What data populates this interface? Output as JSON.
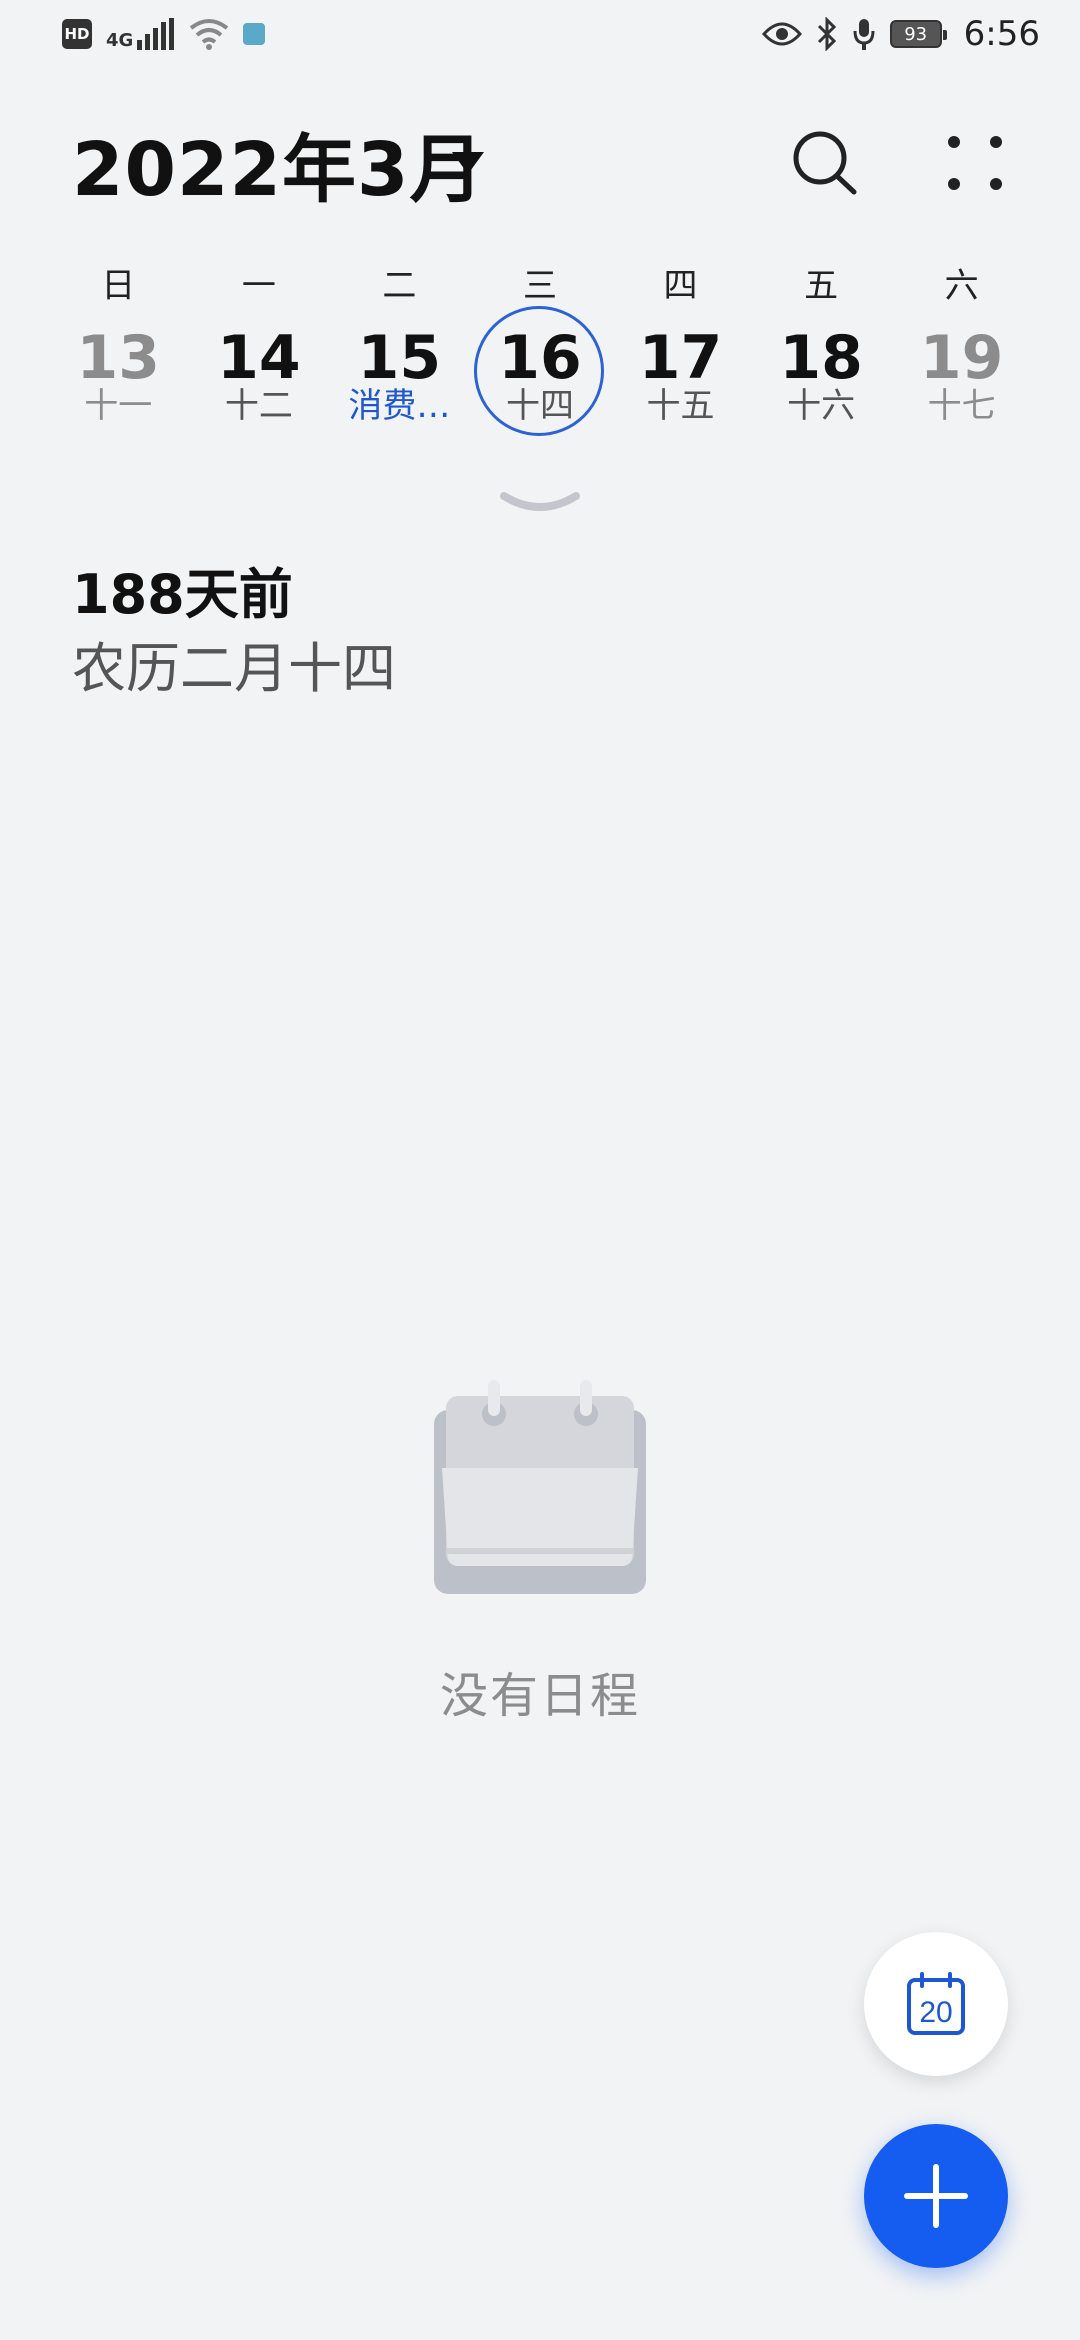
{
  "status_bar": {
    "left_badge": "HD",
    "network": "4G",
    "battery": "93",
    "time": "6:56"
  },
  "header": {
    "month_title": "2022年3月"
  },
  "week": {
    "days": [
      {
        "weekday": "日",
        "date": "13",
        "lunar": "十一"
      },
      {
        "weekday": "一",
        "date": "14",
        "lunar": "十二"
      },
      {
        "weekday": "二",
        "date": "15",
        "lunar": "消费…"
      },
      {
        "weekday": "三",
        "date": "16",
        "lunar": "十四"
      },
      {
        "weekday": "四",
        "date": "17",
        "lunar": "十五"
      },
      {
        "weekday": "五",
        "date": "18",
        "lunar": "十六"
      },
      {
        "weekday": "六",
        "date": "19",
        "lunar": "十七"
      }
    ]
  },
  "info": {
    "days_ago": "188天前",
    "lunar_date": "农历二月十四"
  },
  "empty_state": {
    "message": "没有日程"
  },
  "fab": {
    "today_number": "20"
  },
  "colors": {
    "accent": "#155cf0",
    "today_ring": "#2b62d8",
    "event_text": "#1d57d1",
    "background": "#f1f3f5"
  }
}
